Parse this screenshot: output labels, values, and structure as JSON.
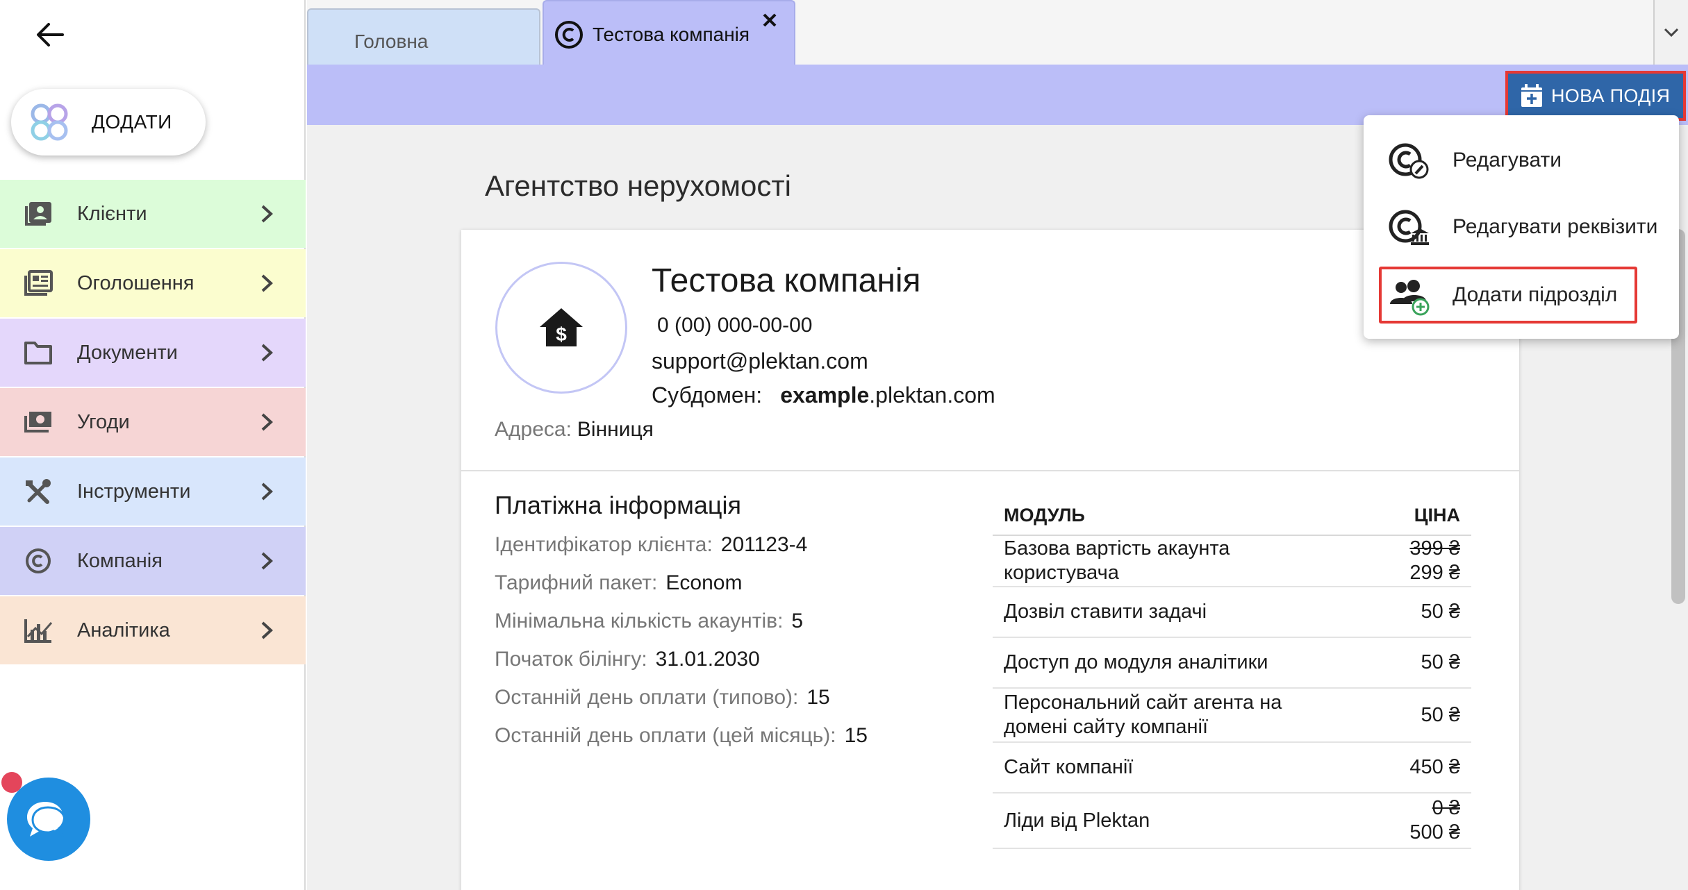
{
  "sidebar": {
    "add_label": "ДОДАТИ",
    "items": [
      {
        "label": "Клієнти",
        "icon": "contacts-icon",
        "bg": "#dcfcd9"
      },
      {
        "label": "Оголошення",
        "icon": "listings-icon",
        "bg": "#fbfdcf"
      },
      {
        "label": "Документи",
        "icon": "folder-icon",
        "bg": "#e4d7fb"
      },
      {
        "label": "Угоди",
        "icon": "money-icon",
        "bg": "#f6d5d5"
      },
      {
        "label": "Інструменти",
        "icon": "tools-icon",
        "bg": "#d8e6fc"
      },
      {
        "label": "Компанія",
        "icon": "copyright-icon",
        "bg": "#d0d1f6"
      },
      {
        "label": "Аналітика",
        "icon": "analytics-icon",
        "bg": "#fae5d4"
      }
    ]
  },
  "tabs": [
    {
      "label": "Головна",
      "active": false
    },
    {
      "label": "Тестова компанія",
      "active": true
    }
  ],
  "toolbar": {
    "new_event_label": "НОВА ПОДІЯ"
  },
  "context_menu": [
    {
      "label": "Редагувати",
      "icon": "company-edit-icon"
    },
    {
      "label": "Редагувати реквізити",
      "icon": "company-bank-icon"
    },
    {
      "label": "Додати підрозділ",
      "icon": "add-group-icon"
    }
  ],
  "page": {
    "title": "Агентство нерухомості"
  },
  "company": {
    "name": "Тестова компанія",
    "phone": "0 (00) 000-00-00",
    "email": "support@plektan.com",
    "subdomain_label": "Субдомен:",
    "subdomain_bold": "example",
    "subdomain_rest": ".plektan.com",
    "address_label": "Адреса:",
    "address_value": "Вінниця"
  },
  "payment": {
    "title": "Платіжна інформація",
    "rows": [
      {
        "label": "Ідентифікатор клієнта:",
        "value": "201123-4"
      },
      {
        "label": "Тарифний пакет:",
        "value": "Econom"
      },
      {
        "label": "Мінімальна кількість акаунтів:",
        "value": "5"
      },
      {
        "label": "Початок білінгу:",
        "value": "31.01.2030"
      },
      {
        "label": "Останній день оплати (типово):",
        "value": "15"
      },
      {
        "label": "Останній день оплати (цей місяць):",
        "value": "15"
      }
    ]
  },
  "modules": {
    "headers": {
      "module": "МОДУЛЬ",
      "price": "ЦІНА"
    },
    "rows": [
      {
        "name": "Базова вартість акаунта користувача",
        "old_price": "399 ₴",
        "price": "299 ₴"
      },
      {
        "name": "Дозвіл ставити задачі",
        "old_price": "",
        "price": "50 ₴"
      },
      {
        "name": "Доступ до модуля аналітики",
        "old_price": "",
        "price": "50 ₴"
      },
      {
        "name": "Персональний сайт агента на домені сайту компанії",
        "old_price": "",
        "price": "50 ₴"
      },
      {
        "name": "Сайт компанії",
        "old_price": "",
        "price": "450 ₴"
      },
      {
        "name": "Ліди від Plektan",
        "old_price": "0 ₴",
        "price": "500 ₴"
      }
    ]
  },
  "colors": {
    "accent": "#2f66a8",
    "tab_active": "#bbbef8",
    "highlight": "#e53935",
    "chat": "#1f8ee0"
  }
}
